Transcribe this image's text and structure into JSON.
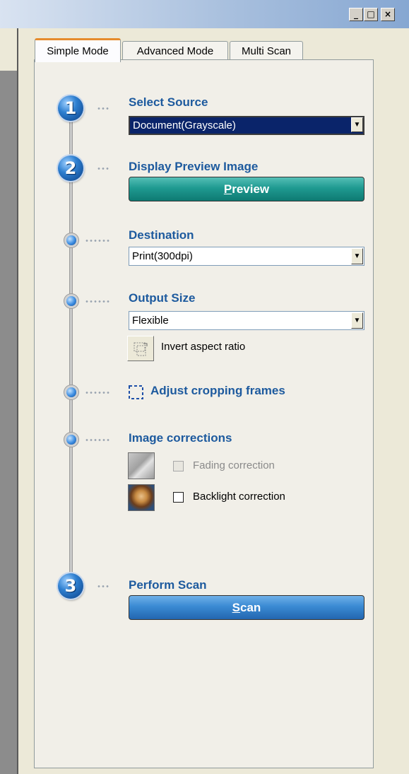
{
  "window": {
    "minimize_glyph": "_",
    "maximize_glyph": "□",
    "close_glyph": "×"
  },
  "tabs": [
    {
      "label": "Simple Mode",
      "active": true
    },
    {
      "label": "Advanced Mode",
      "active": false
    },
    {
      "label": "Multi Scan",
      "active": false
    }
  ],
  "steps": {
    "step1": {
      "number": "1",
      "label": "Select Source"
    },
    "step2": {
      "number": "2",
      "label": "Display Preview Image"
    },
    "step3": {
      "number": "3",
      "label": "Perform Scan"
    }
  },
  "source": {
    "value": "Document(Grayscale)"
  },
  "preview_button": {
    "mnemonic": "P",
    "rest": "review"
  },
  "destination": {
    "label": "Destination",
    "value": "Print(300dpi)"
  },
  "output_size": {
    "label": "Output Size",
    "value": "Flexible",
    "invert_label": "Invert aspect ratio"
  },
  "cropping": {
    "label": "Adjust cropping frames"
  },
  "corrections": {
    "label": "Image corrections",
    "fading": {
      "label": "Fading correction",
      "enabled": false,
      "checked": false
    },
    "backlight": {
      "label": "Backlight correction",
      "enabled": true,
      "checked": false
    }
  },
  "scan_button": {
    "mnemonic": "S",
    "rest": "can"
  },
  "colors": {
    "label_blue": "#1d5a9e",
    "preview_teal": "#1f9a91",
    "scan_blue": "#3a8ad3",
    "tab_accent": "#e68b2c"
  },
  "icons": [
    "step-circle",
    "dotted-connector",
    "dropdown-arrow",
    "invert-aspect-icon",
    "crop-frame-icon",
    "fading-thumbnail",
    "backlight-thumbnail"
  ]
}
